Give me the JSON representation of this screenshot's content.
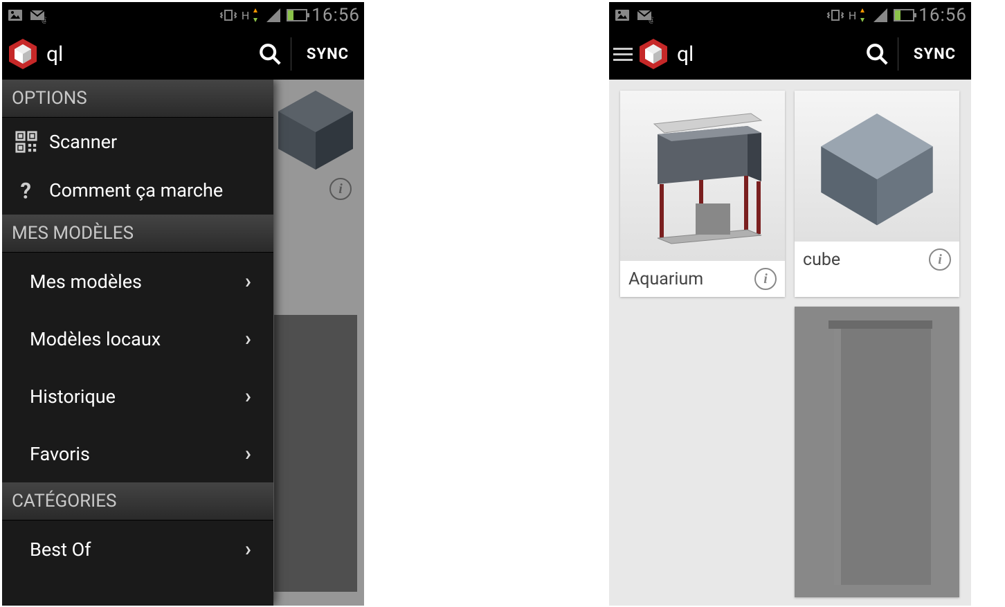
{
  "status": {
    "time": "16:56",
    "network_label": "H"
  },
  "app": {
    "title": "ql",
    "sync_label": "SYNC"
  },
  "drawer": {
    "section_options": "OPTIONS",
    "item_scanner": "Scanner",
    "item_how": "Comment ça marche",
    "section_models": "MES MODÈLES",
    "sub_models": "Mes modèles",
    "sub_local": "Modèles locaux",
    "sub_history": "Historique",
    "sub_favs": "Favoris",
    "section_categories": "CATÉGORIES",
    "sub_bestof": "Best Of"
  },
  "cards": {
    "aquarium": "Aquarium",
    "cube": "cube"
  }
}
